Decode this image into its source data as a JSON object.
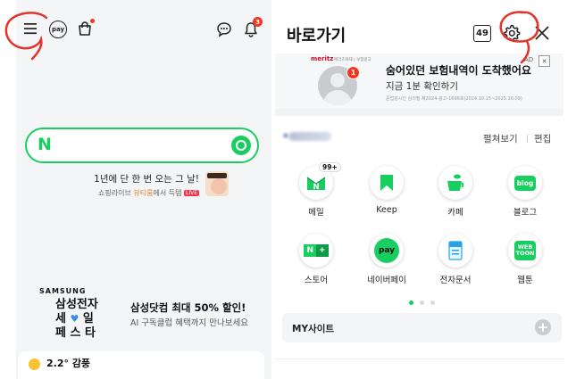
{
  "left": {
    "header_icons": [
      "menu-icon",
      "pay-icon",
      "shopping-bag-icon",
      "chat-icon",
      "bell-icon"
    ],
    "pay_label": "pay",
    "notif_count": "3",
    "search": {
      "logo": "N"
    },
    "promo": {
      "title": "1년에 단 한 번 오는 그 날!",
      "sub_prefix": "쇼핑라이브 ",
      "sub_highlight": "뷰티룸",
      "sub_suffix": "에서 득템 ",
      "live_tag": "LIVE"
    },
    "samsung_ad": {
      "brand": "SAMSUNG",
      "line1": "삼성전자",
      "line2_a": "세",
      "line2_b": "일",
      "line3": "페 스 타",
      "title": "삼성닷컴 최대 50% 할인!",
      "subtitle": "AI 구독클럽 혜택까지 만나보세요"
    },
    "weather": {
      "temp": "2.2° 감풍"
    }
  },
  "right": {
    "title": "바로가기",
    "tab_count": "49",
    "ad": {
      "brand": "meritz",
      "brand_sub": "메리츠화재 | 보험광고",
      "avatar_badge": "1",
      "ad_mark": "AD",
      "close_mark": "✕",
      "headline": "숨어있던 보험내역이 도착했어요",
      "cta": "지금 1분 확인하기",
      "fine_print": "준법감시인 심의필 제2024-광고-1696호(2024.10.15~2025.10.09)"
    },
    "section": {
      "unfold": "펼쳐보기",
      "edit": "편집"
    },
    "services": [
      {
        "label": "메일",
        "badge": "99+",
        "icon": "mail-icon"
      },
      {
        "label": "Keep",
        "icon": "keep-icon"
      },
      {
        "label": "카페",
        "icon": "cafe-icon"
      },
      {
        "label": "블로그",
        "icon": "blog-icon"
      },
      {
        "label": "스토어",
        "icon": "store-icon"
      },
      {
        "label": "네이버페이",
        "icon": "naverpay-icon"
      },
      {
        "label": "전자문서",
        "icon": "edoc-icon"
      },
      {
        "label": "웹툰",
        "icon": "webtoon-icon"
      }
    ],
    "blog_text": "blog",
    "pay_text": "pay",
    "webtoon_text": "WEB TOON",
    "mysite": {
      "label": "MY사이트"
    },
    "colors": {
      "naver_green": "#19ce60",
      "badge_red": "#f2361e",
      "annotation_red": "#e1342a"
    }
  }
}
